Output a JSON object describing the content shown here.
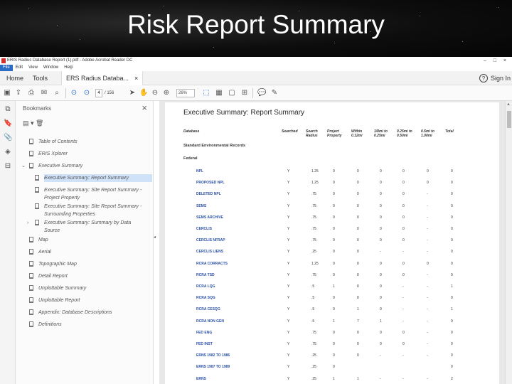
{
  "slide": {
    "title": "Risk Report Summary"
  },
  "window": {
    "title": "ERIS Radius Database Report (1).pdf - Adobe Acrobat Reader DC",
    "controls": "– □ ×"
  },
  "menubar": [
    "File",
    "Edit",
    "View",
    "Window",
    "Help"
  ],
  "tabs": {
    "home": "Home",
    "tools": "Tools",
    "document": "ERS Radius Databa...",
    "close": "×"
  },
  "header": {
    "help_icon": "?",
    "signin": "Sign In"
  },
  "toolbar": {
    "page_current": "4",
    "page_count": "/ 156",
    "zoom": "26%"
  },
  "bookmarks_panel": {
    "title": "Bookmarks",
    "close": "×",
    "tools": "▤ ▾   🗑",
    "items": [
      {
        "label": "Table of Contents"
      },
      {
        "label": "ERIS Xplorer"
      },
      {
        "label": "Executive Summary"
      },
      {
        "label": "Executive Summary: Report Summary"
      },
      {
        "label": "Executive Summary: Site Report Summary -",
        "label2": "Project Property"
      },
      {
        "label": "Executive Summary: Site Report Summary -",
        "label2": "Surrounding Properties"
      },
      {
        "label": "Executive Summary: Summary by Data",
        "label2": "Source"
      },
      {
        "label": "Map"
      },
      {
        "label": "Aerial"
      },
      {
        "label": "Topographic Map"
      },
      {
        "label": "Detail Report"
      },
      {
        "label": "Unplottable Summary"
      },
      {
        "label": "Unplottable Report"
      },
      {
        "label": "Appendix: Database Descriptions"
      },
      {
        "label": "Definitions"
      }
    ]
  },
  "document": {
    "title": "Executive Summary: Report Summary",
    "columns": [
      "Database",
      "Searched",
      "Search\nRadius",
      "Project\nProperty",
      "Within\n0.12mi",
      "1/8mi to\n0.25mi",
      "0.25mi to\n0.50mi",
      "0.5mi to\n1.00mi",
      "Total"
    ],
    "section": "Standard Environmental Records",
    "subsection": "Federal",
    "rows": [
      {
        "name": "NPL",
        "v": [
          "Y",
          "1.25",
          "0",
          "0",
          "0",
          "0",
          "0",
          "0"
        ]
      },
      {
        "name": "PROPOSED NPL",
        "v": [
          "Y",
          "1.25",
          "0",
          "0",
          "0",
          "0",
          "0",
          "0"
        ]
      },
      {
        "name": "DELETED NPL",
        "v": [
          "Y",
          ".75",
          "0",
          "0",
          "0",
          "0",
          "-",
          "0"
        ]
      },
      {
        "name": "SEMS",
        "v": [
          "Y",
          ".75",
          "0",
          "0",
          "0",
          "0",
          "-",
          "0"
        ]
      },
      {
        "name": "SEMS ARCHIVE",
        "v": [
          "Y",
          ".75",
          "0",
          "0",
          "0",
          "0",
          "-",
          "0"
        ]
      },
      {
        "name": "CERCLIS",
        "v": [
          "Y",
          ".75",
          "0",
          "0",
          "0",
          "0",
          "-",
          "0"
        ]
      },
      {
        "name": "CERCLIS NFRAP",
        "v": [
          "Y",
          ".75",
          "0",
          "0",
          "0",
          "0",
          "-",
          "0"
        ]
      },
      {
        "name": "CERCLIS LIENS",
        "v": [
          "Y",
          ".25",
          "0",
          "0",
          "-",
          "-",
          "-",
          "0"
        ]
      },
      {
        "name": "RCRA CORRACTS",
        "v": [
          "Y",
          "1.25",
          "0",
          "0",
          "0",
          "0",
          "0",
          "0"
        ]
      },
      {
        "name": "RCRA TSD",
        "v": [
          "Y",
          ".75",
          "0",
          "0",
          "0",
          "0",
          "-",
          "0"
        ]
      },
      {
        "name": "RCRA LQG",
        "v": [
          "Y",
          ".5",
          "1",
          "0",
          "0",
          "-",
          "-",
          "1"
        ]
      },
      {
        "name": "RCRA SQG",
        "v": [
          "Y",
          ".5",
          "0",
          "0",
          "0",
          "-",
          "-",
          "0"
        ]
      },
      {
        "name": "RCRA CESQG",
        "v": [
          "Y",
          ".5",
          "0",
          "1",
          "0",
          "-",
          "-",
          "1"
        ]
      },
      {
        "name": "RCRA NON GEN",
        "v": [
          "Y",
          ".5",
          "1",
          "7",
          "1",
          "-",
          "-",
          "9"
        ]
      },
      {
        "name": "FED ENG",
        "v": [
          "Y",
          ".75",
          "0",
          "0",
          "0",
          "0",
          "-",
          "0"
        ]
      },
      {
        "name": "FED INST",
        "v": [
          "Y",
          ".75",
          "0",
          "0",
          "0",
          "0",
          "-",
          "0"
        ]
      },
      {
        "name": "ERNS 1982 TO 1986",
        "v": [
          "Y",
          ".25",
          "0",
          "0",
          "-",
          "-",
          "-",
          "0"
        ]
      },
      {
        "name": "ERNS 1987 TO 1989",
        "v": [
          "Y",
          ".25",
          "0",
          "",
          "",
          "",
          "",
          "0"
        ]
      },
      {
        "name": "ERNS",
        "v": [
          "Y",
          ".25",
          "1",
          "1",
          "-",
          "-",
          "-",
          "2"
        ]
      },
      {
        "name": "",
        "v": [
          "",
          "",
          "",
          "",
          "",
          "",
          "",
          "0"
        ]
      }
    ]
  }
}
